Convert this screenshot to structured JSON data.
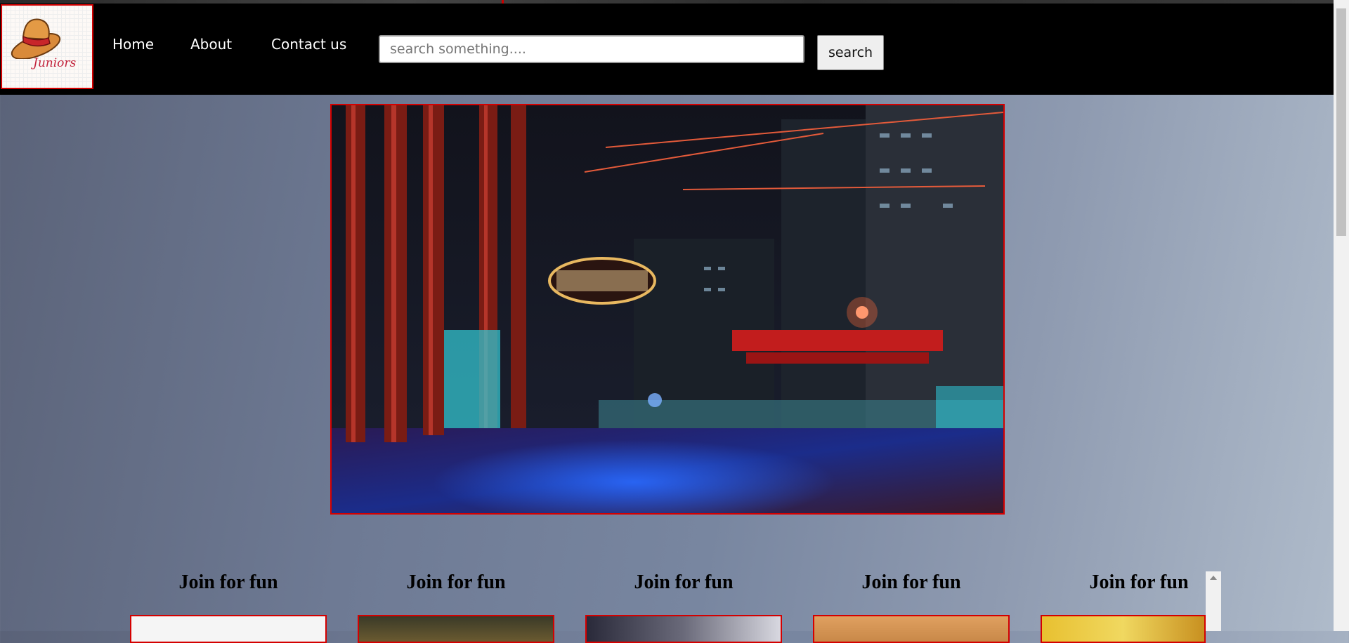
{
  "logo": {
    "text": "Juniors",
    "icon": "hat-icon"
  },
  "nav": {
    "links": [
      {
        "label": "Home"
      },
      {
        "label": "About"
      },
      {
        "label": "Contact us"
      }
    ]
  },
  "search": {
    "placeholder": "search something....",
    "button_label": "search"
  },
  "hero": {
    "icon": "street-photo"
  },
  "cards": [
    {
      "title": "Join for fun"
    },
    {
      "title": "Join for fun"
    },
    {
      "title": "Join for fun"
    },
    {
      "title": "Join for fun"
    },
    {
      "title": "Join for fun"
    }
  ],
  "colors": {
    "accent": "#d40000",
    "navbar": "#000000"
  }
}
